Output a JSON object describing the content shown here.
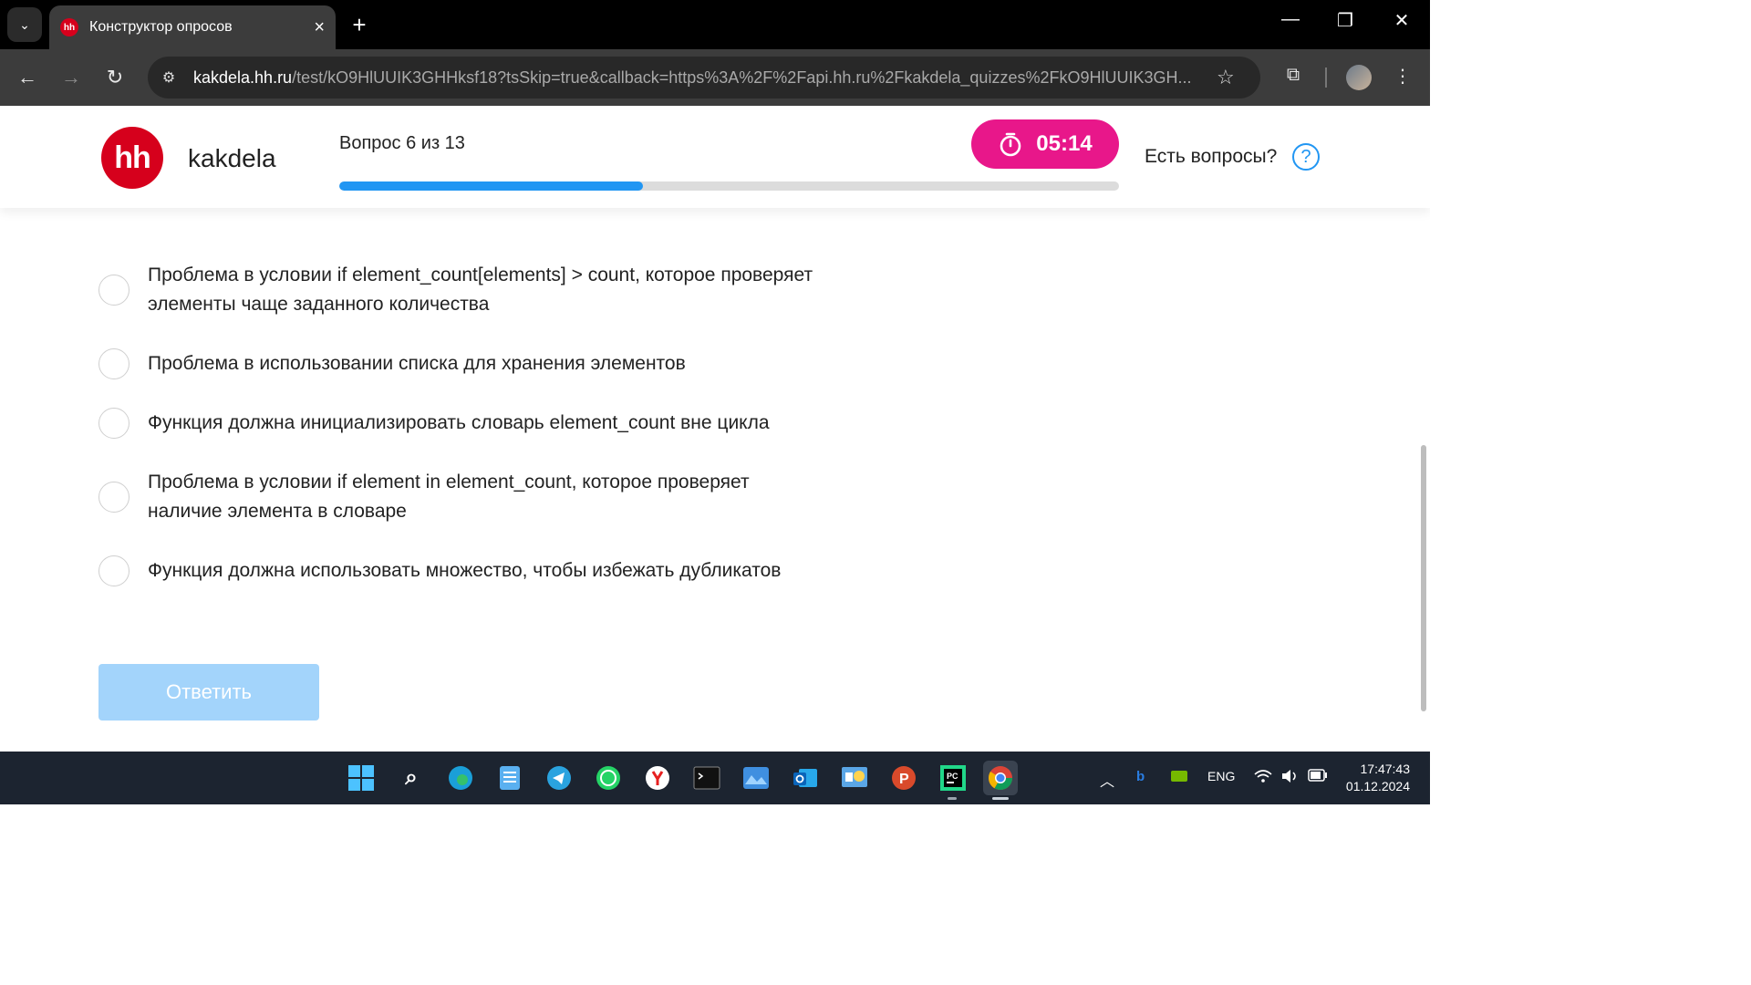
{
  "browser": {
    "tab": {
      "favicon": "hh",
      "title": "Конструктор опросов"
    },
    "url": {
      "host": "kakdela.hh.ru",
      "path": "/test/kO9HlUUIK3GHHksf18?tsSkip=true&callback=https%3A%2F%2Fapi.hh.ru%2Fkakdela_quizzes%2FkO9HlUUIK3GH..."
    }
  },
  "header": {
    "logo": "hh",
    "brand": "kakdela",
    "progress_label": "Вопрос 6 из 13",
    "progress_fraction": 0.39,
    "timer": "05:14",
    "help_text": "Есть вопросы?",
    "help_icon": "?"
  },
  "options": [
    {
      "text": "Проблема в условии if element_count[elements] > count, которое проверяет элементы чаще заданного количества"
    },
    {
      "text": "Проблема в использовании списка для хранения элементов"
    },
    {
      "text": "Функция должна инициализировать словарь element_count вне цикла"
    },
    {
      "text": "Проблема в условии if element in element_count, которое проверяет наличие элемента в словаре"
    },
    {
      "text": "Функция должна использовать множество, чтобы избежать дубликатов"
    }
  ],
  "submit_label": "Ответить",
  "taskbar": {
    "apps": [
      "windows-start-icon",
      "search-icon",
      "edge-icon",
      "notepad-icon",
      "telegram-icon",
      "whatsapp-icon",
      "yandex-icon",
      "terminal-icon",
      "photos-icon",
      "outlook-icon",
      "control-panel-icon",
      "psiphon-icon",
      "pycharm-icon",
      "chrome-icon"
    ],
    "language": "ENG",
    "time": "17:47:43",
    "date": "01.12.2024"
  },
  "colors": {
    "brand_red": "#d6001c",
    "timer_pink": "#e8178a",
    "progress_blue": "#2196f3",
    "submit_disabled": "#a3d4fb"
  }
}
